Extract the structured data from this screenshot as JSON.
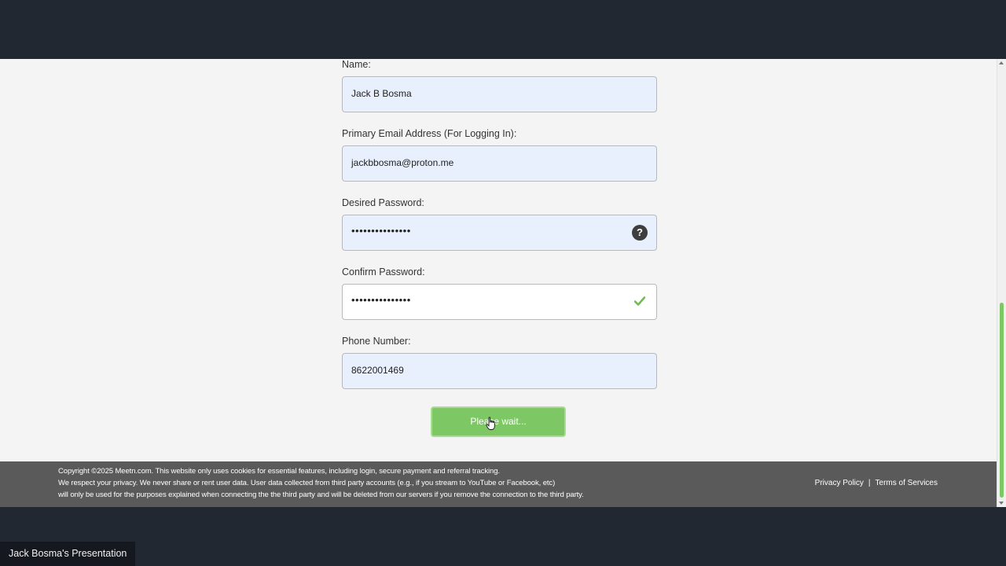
{
  "form": {
    "name_label": "Name:",
    "name_value": "Jack B Bosma",
    "email_label": "Primary Email Address (For Logging In):",
    "email_value": "jackbbosma@proton.me",
    "password_label": "Desired Password:",
    "password_value": "•••••••••••••••",
    "password_help": "?",
    "confirm_label": "Confirm Password:",
    "confirm_value": "•••••••••••••••",
    "phone_label": "Phone Number:",
    "phone_value": "8622001469",
    "submit_label": "Please wait..."
  },
  "footer": {
    "line1": "Copyright ©2025 Meetn.com. This website only uses cookies for essential features, including login, secure payment and referral tracking.",
    "line2": "We respect your privacy. We never share or rent user data. User data collected from third party accounts (e.g., if you stream to YouTube or Facebook, etc)",
    "line3": "will only be used for the purposes explained when connecting the the third party and will be deleted from our servers if you remove the connection to the third party.",
    "privacy_link": "Privacy Policy",
    "separator": "|",
    "terms_link": "Terms of Services"
  },
  "presentation_label": "Jack Bosma's Presentation",
  "colors": {
    "accent_green": "#7ec765",
    "autofill_bg": "#e8f0fe",
    "footer_bg": "#5a5a5a",
    "outer_bg": "#222831"
  },
  "icons": {
    "password_help": "question-circle-icon",
    "confirm_status": "checkmark-icon",
    "pointer": "hand-pointer-icon"
  }
}
